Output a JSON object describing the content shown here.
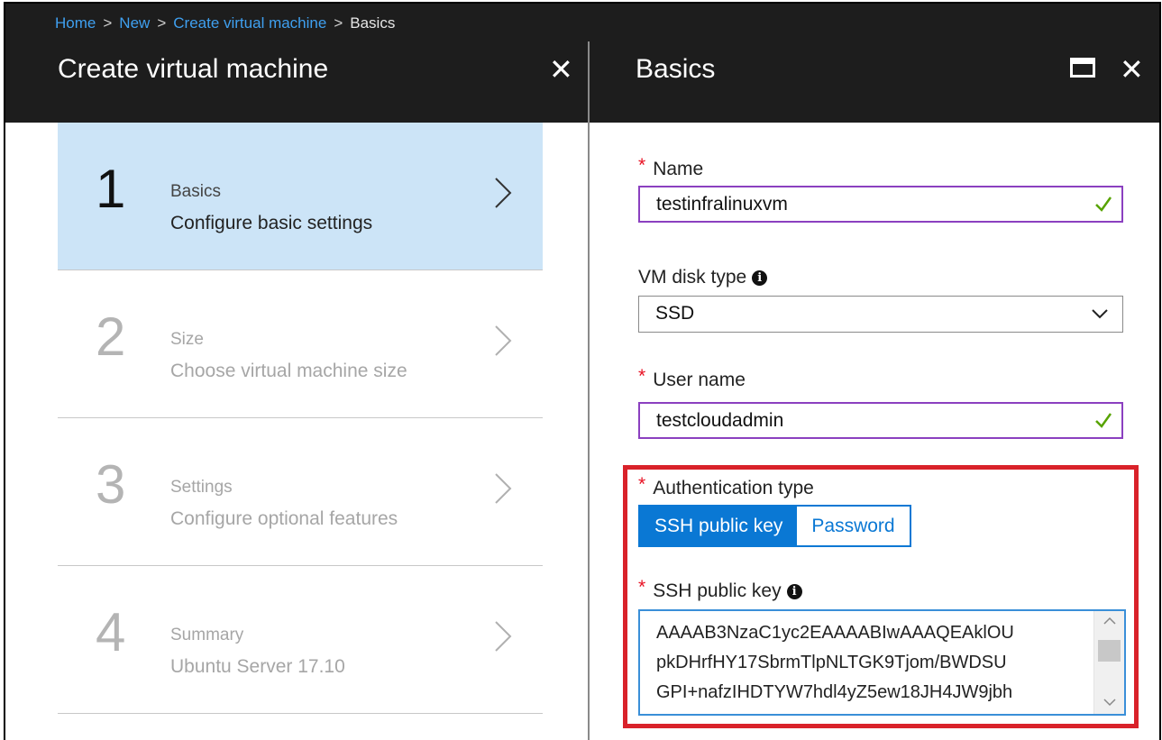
{
  "breadcrumb": {
    "items": [
      "Home",
      "New",
      "Create virtual machine",
      "Basics"
    ],
    "separator": ">"
  },
  "left_blade": {
    "title": "Create virtual machine",
    "close_glyph": "✕",
    "steps": [
      {
        "number": "1",
        "title": "Basics",
        "description": "Configure basic settings",
        "active": true
      },
      {
        "number": "2",
        "title": "Size",
        "description": "Choose virtual machine size",
        "active": false
      },
      {
        "number": "3",
        "title": "Settings",
        "description": "Configure optional features",
        "active": false
      },
      {
        "number": "4",
        "title": "Summary",
        "description": "Ubuntu Server 17.10",
        "active": false
      }
    ]
  },
  "right_blade": {
    "title": "Basics",
    "close_glyph": "✕",
    "required_mark": "*",
    "info_glyph": "i",
    "name": {
      "label": "Name",
      "value": "testinfralinuxvm"
    },
    "disk_type": {
      "label": "VM disk type",
      "value": "SSD"
    },
    "user_name": {
      "label": "User name",
      "value": "testcloudadmin"
    },
    "auth_type": {
      "label": "Authentication type",
      "options": [
        "SSH public key",
        "Password"
      ],
      "selected": "SSH public key"
    },
    "ssh_key": {
      "label": "SSH public key",
      "lines": [
        "AAAAB3NzaC1yc2EAAAABIwAAAQEAklOU",
        "pkDHrfHY17SbrmTlpNLTGK9Tjom/BWDSU",
        "GPI+nafzIHDTYW7hdl4yZ5ew18JH4JW9jbh"
      ]
    }
  },
  "colors": {
    "topbar": "#1d1d1d",
    "active_step": "#cce4f7",
    "accent_blue": "#0a78d4",
    "valid_border": "#8b40c0",
    "valid_check": "#57a300",
    "required": "#e81123",
    "highlight": "#d9222a"
  },
  "icons": {
    "close": "close-icon",
    "maximize": "maximize-icon",
    "chevron": "chevron-right-icon",
    "check": "checkmark-icon",
    "dropdown": "chevron-down-icon",
    "info": "info-icon"
  }
}
